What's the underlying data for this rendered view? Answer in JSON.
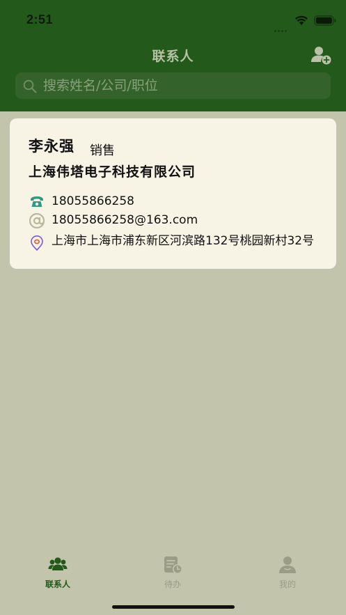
{
  "status_bar": {
    "time": "2:51"
  },
  "nav": {
    "title": "联系人",
    "add_contact_icon": "add-user-icon"
  },
  "search": {
    "placeholder": "搜索姓名/公司/职位",
    "value": ""
  },
  "contacts": [
    {
      "name": "李永强",
      "position": "销售",
      "company": "上海伟塔电子科技有限公司",
      "phone": "18055866258",
      "email": "18055866258@163.com",
      "address": "上海市上海市浦东新区河滨路132号桃园新村32号"
    }
  ],
  "tabs": [
    {
      "label": "联系人",
      "icon": "contacts-icon",
      "active": true
    },
    {
      "label": "待办",
      "icon": "todo-icon",
      "active": false
    },
    {
      "label": "我的",
      "icon": "profile-icon",
      "active": false
    }
  ],
  "colors": {
    "header": "#235a1b",
    "background": "#c2c4ac",
    "card": "#f7f4e6",
    "tab_active": "#235a1b",
    "tab_inactive": "#9a9c86"
  }
}
